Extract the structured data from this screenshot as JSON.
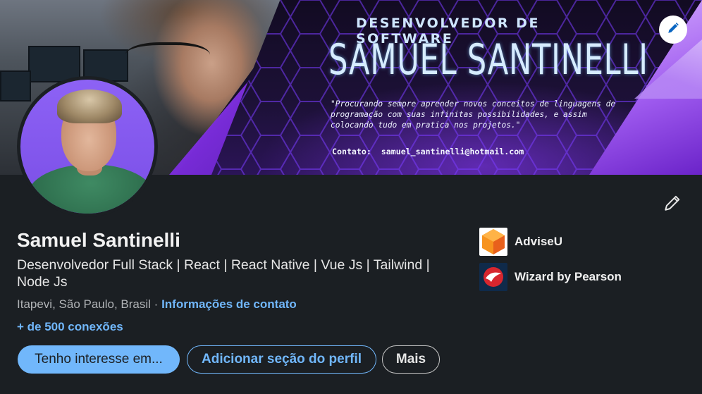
{
  "banner": {
    "subtitle": "DESENVOLVEDOR DE SOFTWARE",
    "name": "SAMUEL SANTINELLI",
    "quote": "\"Procurando sempre aprender novos conceitos de linguagens de programação com suas infinitas possibilidades, e assim colocando tudo em pratica nos projetos.\"",
    "contact": "Contato:  samuel_santinelli@hotmail.com",
    "edit_icon": "pencil-icon"
  },
  "profile": {
    "name": "Samuel Santinelli",
    "headline": "Desenvolvedor Full Stack | React | React Native | Vue Js | Tailwind | Node Js",
    "location": "Itapevi, São Paulo, Brasil",
    "separator": " · ",
    "contact_info_link": "Informações de contato",
    "connections": "+ de 500 conexões",
    "edit_icon": "pencil-icon"
  },
  "actions": {
    "open_to": "Tenho interesse em...",
    "add_section": "Adicionar seção do perfil",
    "more": "Mais"
  },
  "organizations": [
    {
      "name": "AdviseU",
      "logo": "adviseu-logo"
    },
    {
      "name": "Wizard by Pearson",
      "logo": "wizard-logo"
    }
  ],
  "colors": {
    "background": "#1b1f23",
    "accent_blue": "#71b7fb",
    "banner_purple": "#7d2de0"
  }
}
